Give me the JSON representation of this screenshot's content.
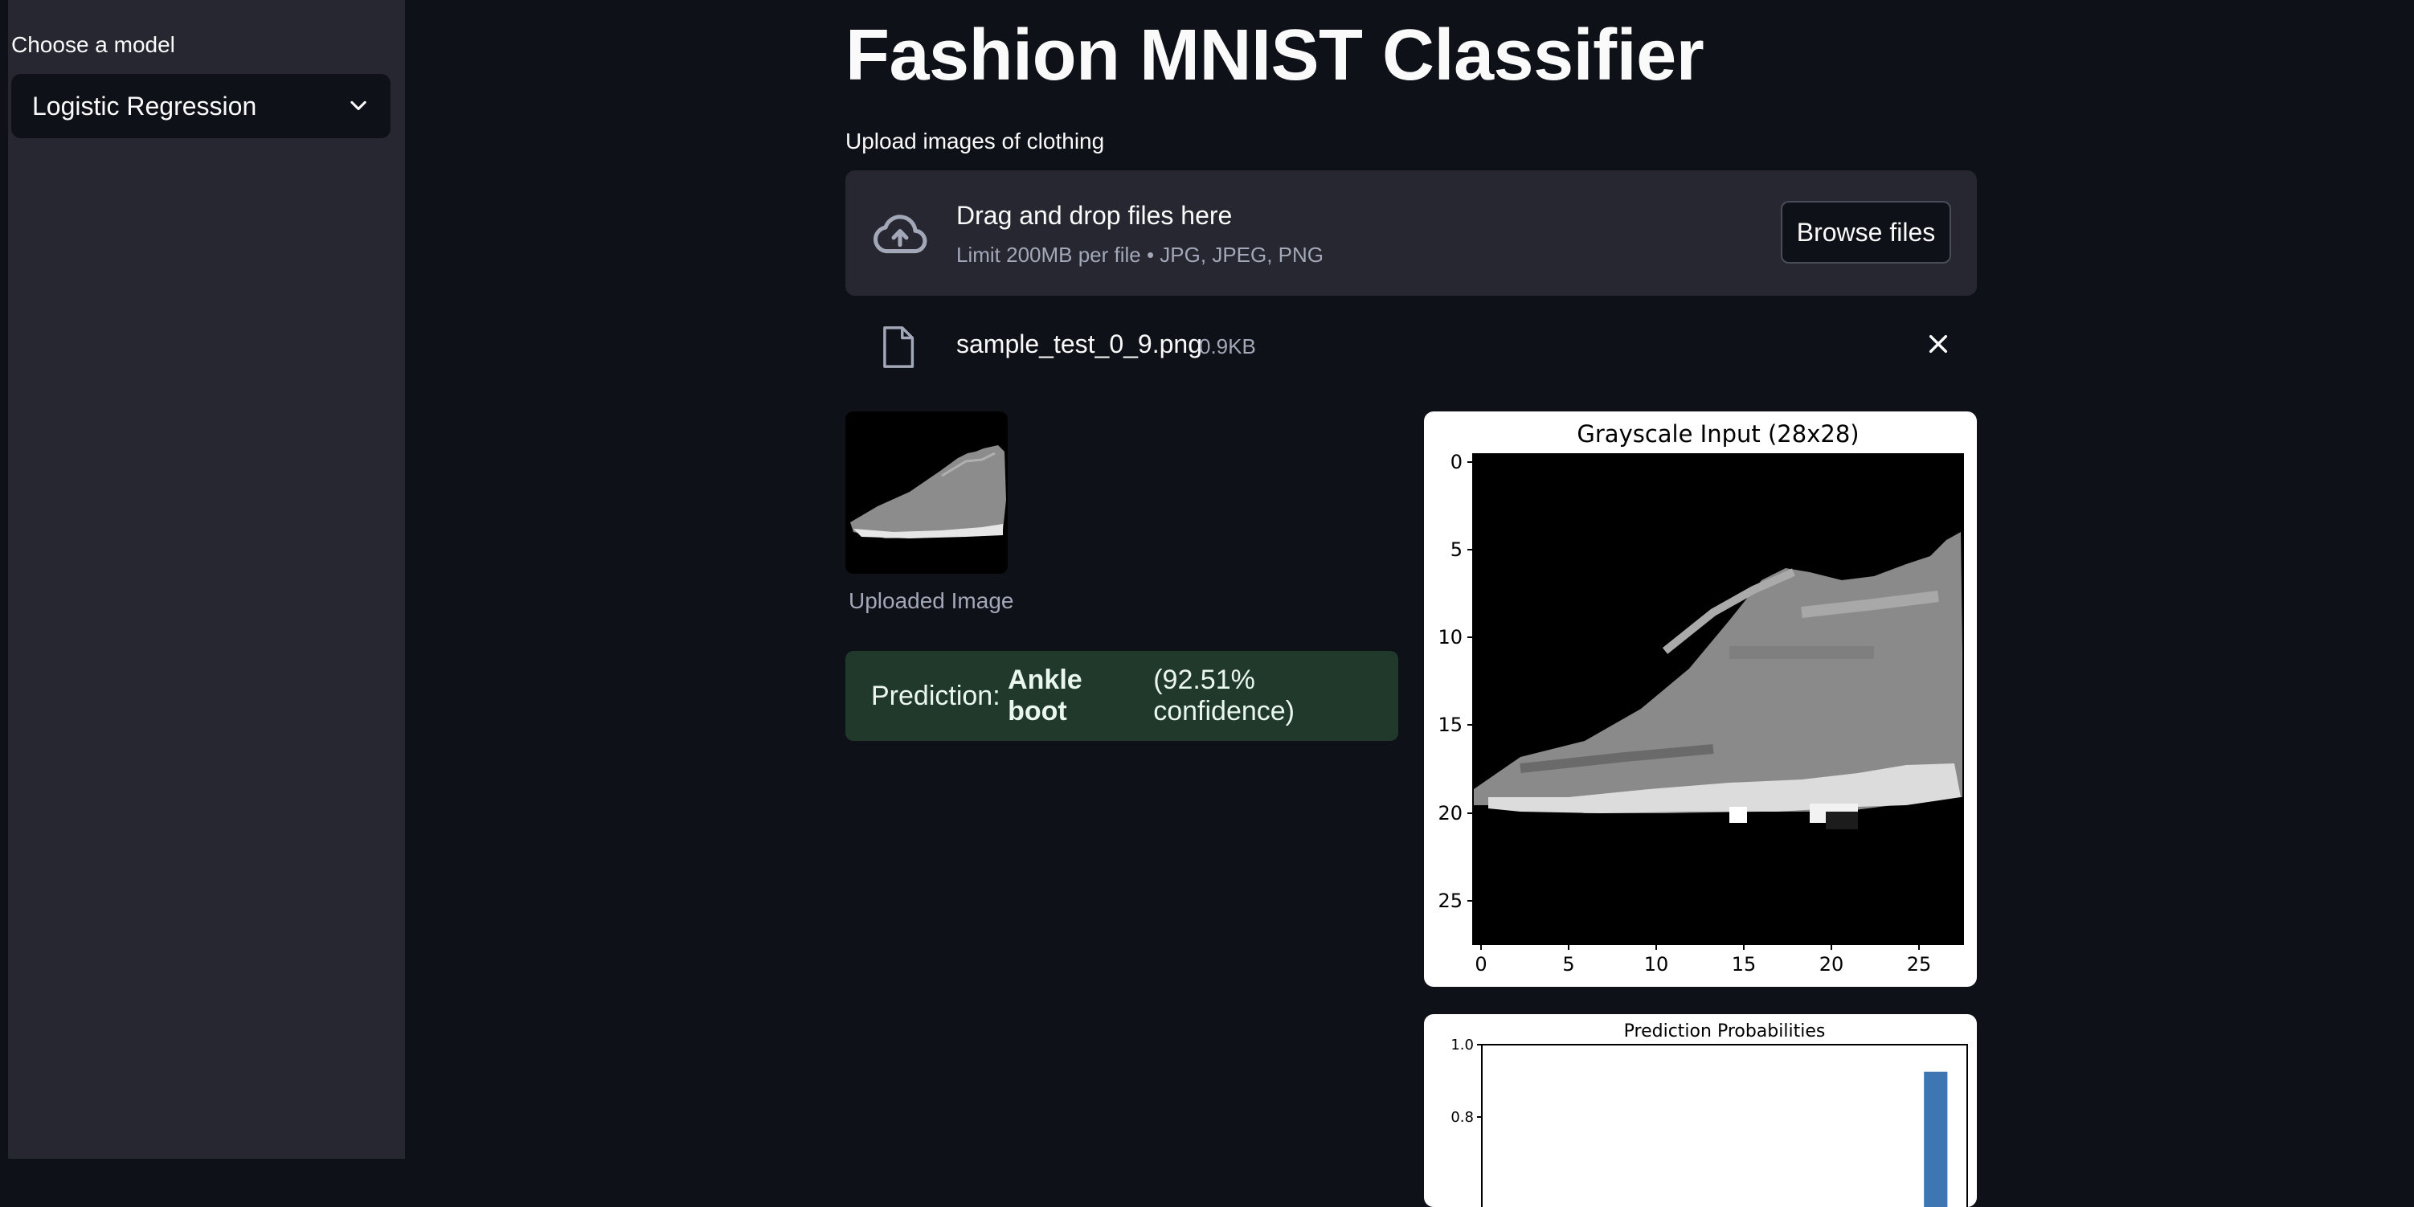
{
  "sidebar": {
    "label": "Choose a model",
    "selected_model": "Logistic Regression"
  },
  "main": {
    "title": "Fashion MNIST Classifier",
    "upload_label": "Upload images of clothing",
    "dropzone": {
      "title": "Drag and drop files here",
      "subtitle": "Limit 200MB per file • JPG, JPEG, PNG",
      "browse_label": "Browse files"
    },
    "file": {
      "name": "sample_test_0_9.png",
      "size": "0.9KB"
    },
    "uploaded_caption": "Uploaded Image",
    "prediction": {
      "prefix": "Prediction: ",
      "label": "Ankle boot",
      "confidence": "(92.51% confidence)"
    }
  },
  "grayscale_plot": {
    "title": "Grayscale Input (28x28)",
    "y_ticks": [
      "0",
      "5",
      "10",
      "15",
      "20",
      "25"
    ],
    "x_ticks": [
      "0",
      "5",
      "10",
      "15",
      "20",
      "25"
    ]
  },
  "chart_data": {
    "type": "bar",
    "title": "Prediction Probabilities",
    "y_ticks": [
      "1.0",
      "0.8"
    ],
    "ylim": [
      0,
      1.0
    ],
    "values": [
      0.0,
      0.0,
      0.0,
      0.0,
      0.0,
      0.0,
      0.0,
      0.0,
      0.0,
      0.9251
    ],
    "bar_color": "#3d76b3"
  },
  "colors": {
    "background": "#0e1117",
    "sidebar": "#262730",
    "success_bg": "#21392b"
  }
}
